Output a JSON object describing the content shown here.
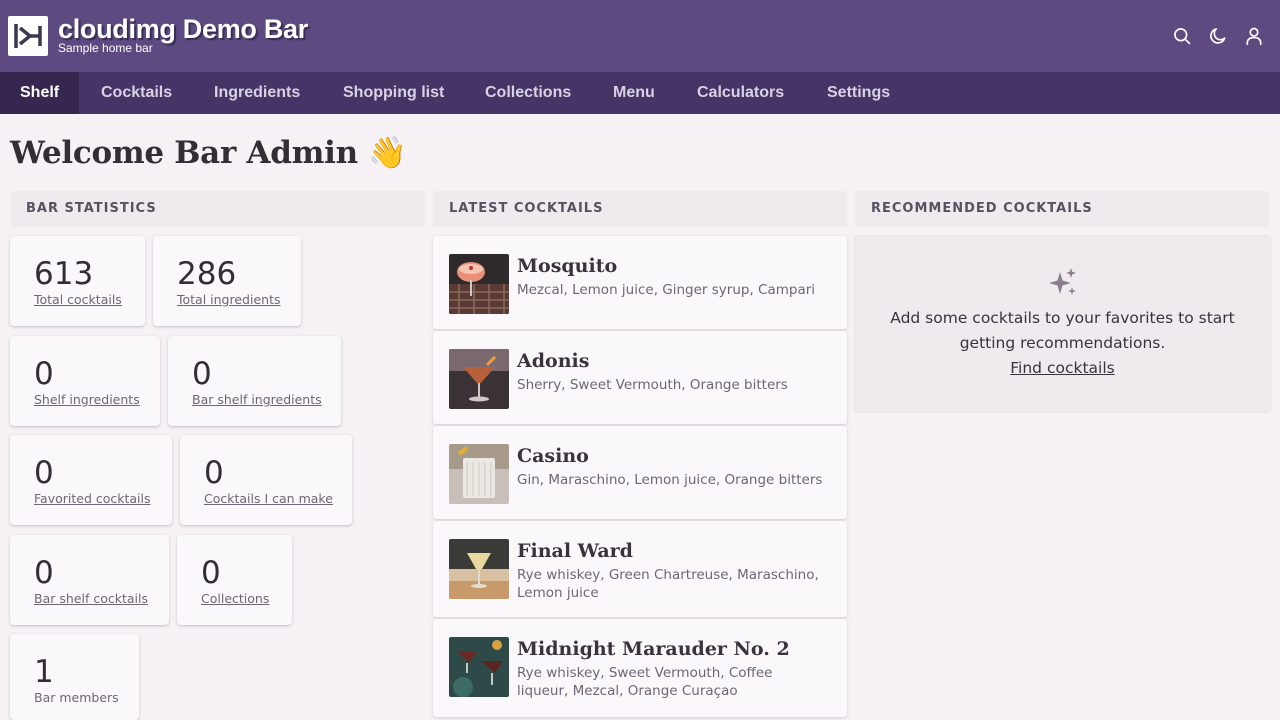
{
  "header": {
    "title": "cloudimg Demo Bar",
    "subtitle": "Sample home bar",
    "icons": [
      "search-icon",
      "moon-icon",
      "user-icon"
    ]
  },
  "nav": {
    "tabs": [
      {
        "label": "Shelf",
        "active": true
      },
      {
        "label": "Cocktails",
        "active": false
      },
      {
        "label": "Ingredients",
        "active": false
      },
      {
        "label": "Shopping list",
        "active": false
      },
      {
        "label": "Collections",
        "active": false
      },
      {
        "label": "Menu",
        "active": false
      },
      {
        "label": "Calculators",
        "active": false
      },
      {
        "label": "Settings",
        "active": false
      }
    ]
  },
  "page": {
    "title": "Welcome Bar Admin 👋"
  },
  "stats": {
    "heading": "BAR STATISTICS",
    "items": [
      {
        "value": "613",
        "label": "Total cocktails"
      },
      {
        "value": "286",
        "label": "Total ingredients"
      },
      {
        "value": "0",
        "label": "Shelf ingredients"
      },
      {
        "value": "0",
        "label": "Bar shelf ingredients"
      },
      {
        "value": "0",
        "label": "Favorited cocktails"
      },
      {
        "value": "0",
        "label": "Cocktails I can make"
      },
      {
        "value": "0",
        "label": "Bar shelf cocktails"
      },
      {
        "value": "0",
        "label": "Collections"
      },
      {
        "value": "1",
        "label": "Bar members"
      }
    ]
  },
  "latest": {
    "heading": "LATEST COCKTAILS",
    "items": [
      {
        "name": "Mosquito",
        "ingredients": "Mezcal, Lemon juice, Ginger syrup, Campari"
      },
      {
        "name": "Adonis",
        "ingredients": "Sherry, Sweet Vermouth, Orange bitters"
      },
      {
        "name": "Casino",
        "ingredients": "Gin, Maraschino, Lemon juice, Orange bitters"
      },
      {
        "name": "Final Ward",
        "ingredients": "Rye whiskey, Green Chartreuse, Maraschino, Lemon juice"
      },
      {
        "name": "Midnight Marauder No. 2",
        "ingredients": "Rye whiskey, Sweet Vermouth, Coffee liqueur, Mezcal, Orange Curaçao"
      }
    ]
  },
  "recommended": {
    "heading": "RECOMMENDED COCKTAILS",
    "message": "Add some cocktails to your favorites to start getting recommendations.",
    "link": "Find cocktails",
    "icon": "sparkles-icon"
  },
  "colors": {
    "header_bg": "#5c4a80",
    "nav_bg": "#453466",
    "nav_active_bg": "#35274f",
    "page_bg": "#f5f1f4"
  }
}
